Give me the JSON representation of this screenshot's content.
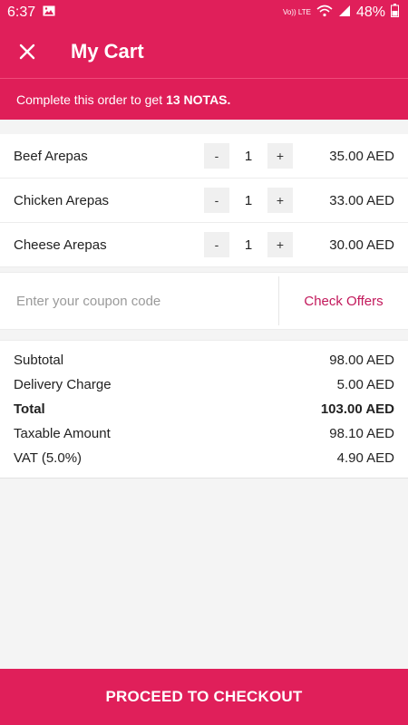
{
  "status_bar": {
    "time": "6:37",
    "network": "Vo)) LTE",
    "battery": "48%"
  },
  "header": {
    "title": "My Cart"
  },
  "promo": {
    "text": "Complete this order to get",
    "highlight": "13 NOTAS."
  },
  "cart": {
    "items": [
      {
        "name": "Beef Arepas",
        "minus": "-",
        "qty": "1",
        "plus": "+",
        "price": "35.00 AED"
      },
      {
        "name": "Chicken Arepas",
        "minus": "-",
        "qty": "1",
        "plus": "+",
        "price": "33.00 AED"
      },
      {
        "name": "Cheese Arepas",
        "minus": "-",
        "qty": "1",
        "plus": "+",
        "price": "30.00 AED"
      }
    ]
  },
  "coupon": {
    "placeholder": "Enter your coupon code",
    "value": "",
    "check_offers": "Check Offers"
  },
  "summary": {
    "subtotal_label": "Subtotal",
    "subtotal_value": "98.00 AED",
    "delivery_label": "Delivery Charge",
    "delivery_value": "5.00 AED",
    "total_label": "Total",
    "total_value": "103.00 AED",
    "taxable_label": "Taxable Amount",
    "taxable_value": "98.10 AED",
    "vat_label": "VAT (5.0%)",
    "vat_value": "4.90 AED"
  },
  "checkout": {
    "label": "PROCEED TO CHECKOUT"
  },
  "colors": {
    "accent": "#e01f5a",
    "link": "#c2185b"
  }
}
